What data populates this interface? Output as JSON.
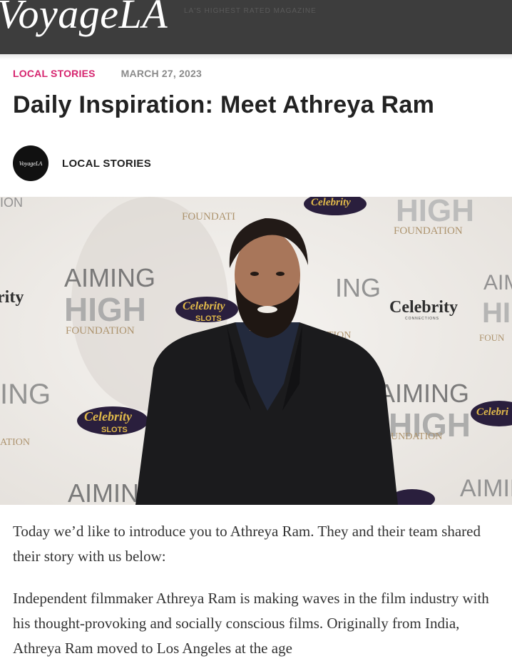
{
  "site": {
    "logo_text": "VoyageLA",
    "tagline": "LA'S HIGHEST RATED MAGAZINE",
    "avatar_text": "VoyageLA"
  },
  "article": {
    "category": "LOCAL STORIES",
    "date": "MARCH 27, 2023",
    "title": "Daily Inspiration: Meet Athreya Ram",
    "author": "LOCAL STORIES"
  },
  "photo": {
    "backdrop_text": {
      "aiming": "AIMING",
      "high": "HIGH",
      "foundation": "FOUNDATION",
      "celebrity": "Celebrity",
      "connections": "CONNECTIONS",
      "slots": "SLOTS"
    }
  },
  "body": {
    "paragraph_1": "Today we’d like to introduce you to Athreya Ram. They and their team shared their story with us below:",
    "paragraph_2": "Independent filmmaker Athreya Ram is making waves in the film industry with his thought-provoking and socially conscious films. Originally from India, Athreya Ram moved to Los Angeles at the age"
  },
  "colors": {
    "header_bg": "#3d3d3d",
    "category_accent": "#d6246e"
  }
}
